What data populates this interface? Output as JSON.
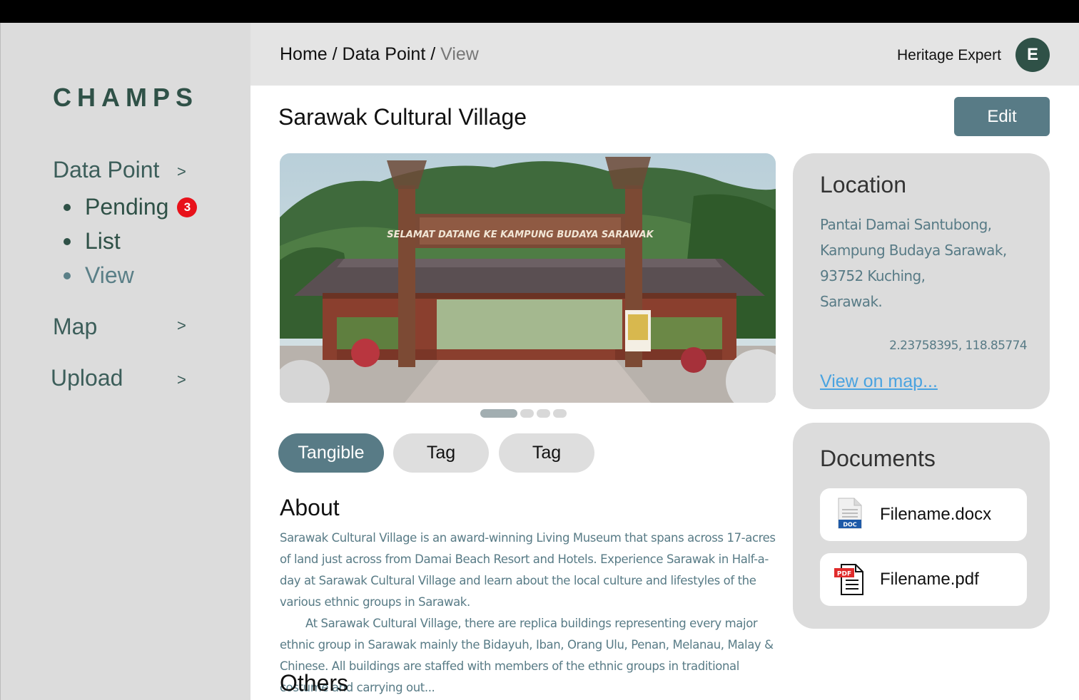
{
  "brand": "CHAMPS",
  "sidebar": {
    "items": [
      {
        "label": "Data Point",
        "chevron": ">"
      },
      {
        "label": "Map",
        "chevron": ">"
      },
      {
        "label": "Upload",
        "chevron": ">"
      }
    ],
    "subitems": [
      {
        "label": "Pending",
        "badge": "3"
      },
      {
        "label": "List"
      },
      {
        "label": "View"
      }
    ]
  },
  "header": {
    "breadcrumb": [
      "Home",
      "Data Point",
      "View"
    ],
    "separator": " / ",
    "user_name": "Heritage Expert",
    "avatar_initial": "E"
  },
  "page": {
    "title": "Sarawak Cultural Village",
    "edit_label": "Edit",
    "carousel": {
      "slides": 4,
      "active": 0
    },
    "photo_sign": "SELAMAT DATANG KE KAMPUNG BUDAYA SARAWAK",
    "tags": [
      "Tangible",
      "Tag",
      "Tag"
    ],
    "about_title": "About",
    "about_paragraphs": [
      "Sarawak Cultural Village is an award-winning Living Museum that spans across 17-acres of land just across from Damai Beach Resort and Hotels. Experience Sarawak in Half-a-day at Sarawak Cultural Village and learn about the local culture and lifestyles of the various ethnic groups in Sarawak.",
      "At Sarawak Cultural Village, there are replica buildings representing every major ethnic group in Sarawak mainly the Bidayuh, Iban, Orang Ulu, Penan, Melanau, Malay & Chinese. All buildings are staffed with members of the ethnic groups in traditional costume and carrying out..."
    ],
    "others_title": "Others"
  },
  "location": {
    "title": "Location",
    "address_lines": [
      "Pantai Damai Santubong,",
      "Kampung Budaya Sarawak,",
      "93752 Kuching,",
      "Sarawak."
    ],
    "coordinates": "2.23758395, 118.85774",
    "map_link": "View on map..."
  },
  "documents": {
    "title": "Documents",
    "files": [
      {
        "name": "Filename.docx",
        "icon": "docx-file-icon",
        "icon_label": "DOC"
      },
      {
        "name": "Filename.pdf",
        "icon": "pdf-file-icon",
        "icon_label": "PDF"
      }
    ]
  },
  "colors": {
    "accent": "#587b86",
    "brand": "#2f5147",
    "badge": "#e8111a",
    "link": "#4aa3e0"
  }
}
